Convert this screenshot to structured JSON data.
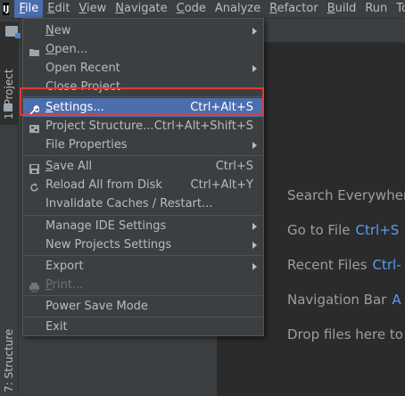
{
  "menubar": {
    "logo": "IJ",
    "items": [
      "File",
      "Edit",
      "View",
      "Navigate",
      "Code",
      "Analyze",
      "Refactor",
      "Build",
      "Run",
      "To"
    ]
  },
  "tool_windows": {
    "project": "1: Project",
    "structure": "7: Structure"
  },
  "file_menu": {
    "new": "New",
    "open": "Open...",
    "open_recent": "Open Recent",
    "close_project": "Close Project",
    "settings": "Settings...",
    "settings_shortcut": "Ctrl+Alt+S",
    "project_structure": "Project Structure...",
    "project_structure_shortcut": "Ctrl+Alt+Shift+S",
    "file_properties": "File Properties",
    "save_all": "Save All",
    "save_all_shortcut": "Ctrl+S",
    "reload": "Reload All from Disk",
    "reload_shortcut": "Ctrl+Alt+Y",
    "invalidate": "Invalidate Caches / Restart...",
    "manage_ide": "Manage IDE Settings",
    "new_projects_settings": "New Projects Settings",
    "export": "Export",
    "print": "Print...",
    "power_save": "Power Save Mode",
    "exit": "Exit"
  },
  "editor_hints": {
    "search": "Search Everywhere",
    "goto_file": "Go to File",
    "goto_file_shortcut": "Ctrl+S",
    "recent_files": "Recent Files",
    "recent_files_shortcut": "Ctrl-",
    "nav_bar": "Navigation Bar",
    "nav_bar_shortcut": "A",
    "drop": "Drop files here to"
  },
  "colors": {
    "highlight": "#e53935",
    "selection": "#4b6eaf",
    "shortcut": "#589df6"
  }
}
